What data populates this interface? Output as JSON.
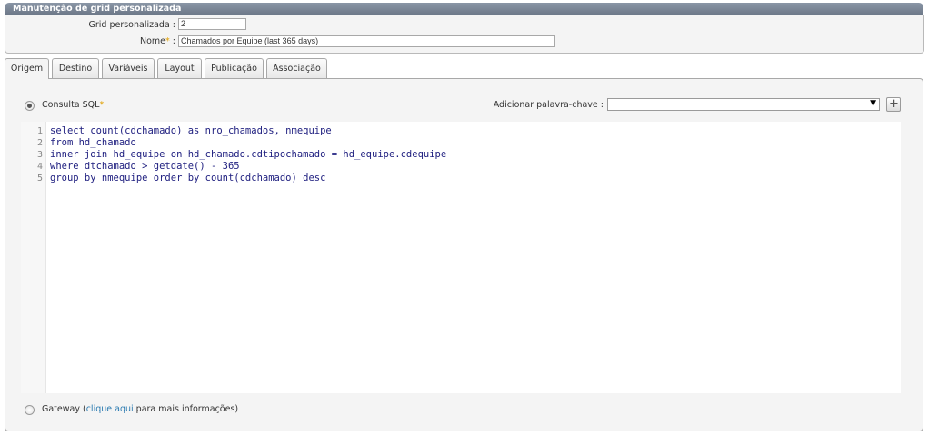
{
  "panel": {
    "title": "Manutenção de grid personalizada"
  },
  "form": {
    "grid_label": "Grid personalizada :",
    "grid_value": "2",
    "nome_label": "Nome",
    "nome_req": "*",
    "nome_sep": ":",
    "nome_value": "Chamados por Equipe (last 365 days)"
  },
  "tabs": [
    {
      "label": "Origem"
    },
    {
      "label": "Destino"
    },
    {
      "label": "Variáveis"
    },
    {
      "label": "Layout"
    },
    {
      "label": "Publicação"
    },
    {
      "label": "Associação"
    }
  ],
  "origem": {
    "consulta_label": "Consulta SQL",
    "consulta_req": "*",
    "keyword_label": "Adicionar palavra-chave :",
    "keyword_value": "",
    "gateway_label": "Gateway (",
    "gateway_link": "clique aqui",
    "gateway_suffix": " para mais informações)"
  },
  "sql": {
    "line_numbers": [
      "1",
      "2",
      "3",
      "4",
      "5"
    ],
    "lines": [
      "select count(cdchamado) as nro_chamados, nmequipe",
      "from hd_chamado",
      "inner join hd_equipe on hd_chamado.cdtipochamado = hd_equipe.cdequipe",
      "where dtchamado > getdate() - 365",
      "group by nmequipe order by count(cdchamado) desc"
    ]
  },
  "icons": {
    "dropdown": "chevron-down-icon",
    "add": "plus-icon"
  }
}
